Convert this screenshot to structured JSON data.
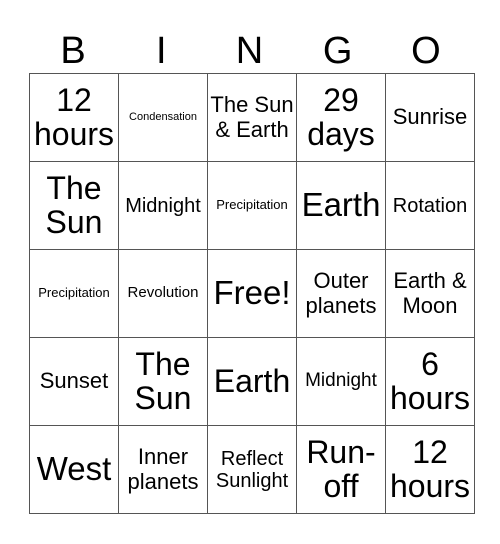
{
  "header": [
    "B",
    "I",
    "N",
    "G",
    "O"
  ],
  "grid": [
    [
      "12 hours",
      "Condensation",
      "The Sun & Earth",
      "29 days",
      "Sunrise"
    ],
    [
      "The Sun",
      "Midnight",
      "Precipitation",
      "Earth",
      "Rotation"
    ],
    [
      "Precipitation",
      "Revolution",
      "Free!",
      "Outer planets",
      "Earth & Moon"
    ],
    [
      "Sunset",
      "The Sun",
      "Earth",
      "Midnight",
      "6 hours"
    ],
    [
      "West",
      "Inner planets",
      "Reflect Sunlight",
      "Run-off",
      "12 hours"
    ]
  ],
  "free_space": {
    "row": 2,
    "col": 2
  }
}
